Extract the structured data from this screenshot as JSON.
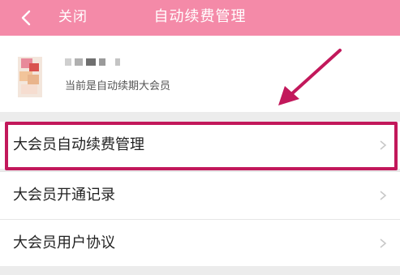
{
  "topbar": {
    "close_label": "关闭",
    "title": "自动续费管理"
  },
  "profile": {
    "status_text": "当前是自动续期大会员"
  },
  "menu": {
    "items": [
      {
        "label": "大会员自动续费管理"
      },
      {
        "label": "大会员开通记录"
      },
      {
        "label": "大会员用户协议"
      }
    ]
  },
  "icons": {
    "back": "chevron-left-icon",
    "chevron": "chevron-right-icon",
    "annotation": "annotation-arrow-icon"
  },
  "colors": {
    "header": "#f48aa8",
    "highlight": "#c2185b",
    "annotation_arrow": "#c2185b"
  }
}
